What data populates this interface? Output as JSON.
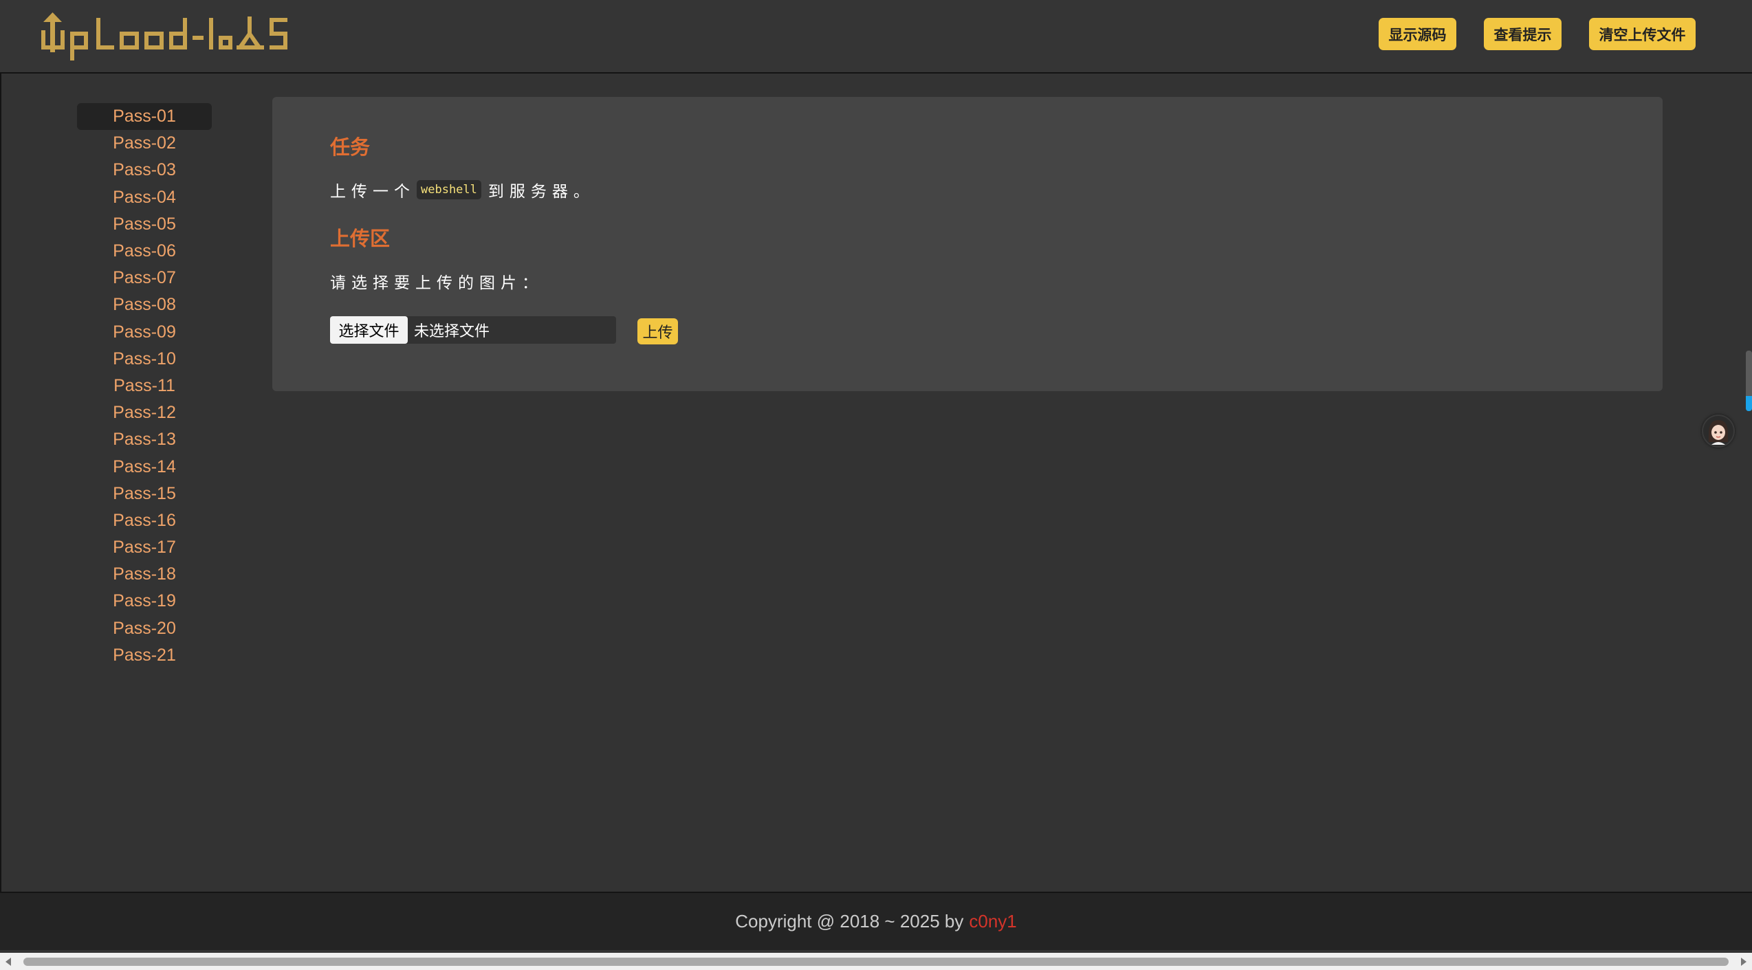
{
  "header": {
    "logo_text": "Upload-labs",
    "buttons": [
      "显示源码",
      "查看提示",
      "清空上传文件"
    ]
  },
  "sidebar": {
    "items": [
      "Pass-01",
      "Pass-02",
      "Pass-03",
      "Pass-04",
      "Pass-05",
      "Pass-06",
      "Pass-07",
      "Pass-08",
      "Pass-09",
      "Pass-10",
      "Pass-11",
      "Pass-12",
      "Pass-13",
      "Pass-14",
      "Pass-15",
      "Pass-16",
      "Pass-17",
      "Pass-18",
      "Pass-19",
      "Pass-20",
      "Pass-21"
    ],
    "active_index": 0
  },
  "main": {
    "task_heading": "任务",
    "task_prefix": "上传一个",
    "task_code": "webshell",
    "task_suffix": "到服务器。",
    "upload_heading": "上传区",
    "upload_prompt": "请选择要上传的图片：",
    "choose_file_label": "选择文件",
    "no_file_label": "未选择文件",
    "upload_button": "上传"
  },
  "footer": {
    "copyright": "Copyright @ 2018 ~ 2025 by",
    "author": "c0ny1"
  },
  "colors": {
    "accent_yellow": "#f2c641",
    "heading_orange": "#e06e32",
    "nav_orange": "#f0a46a",
    "author_red": "#d4342a"
  }
}
